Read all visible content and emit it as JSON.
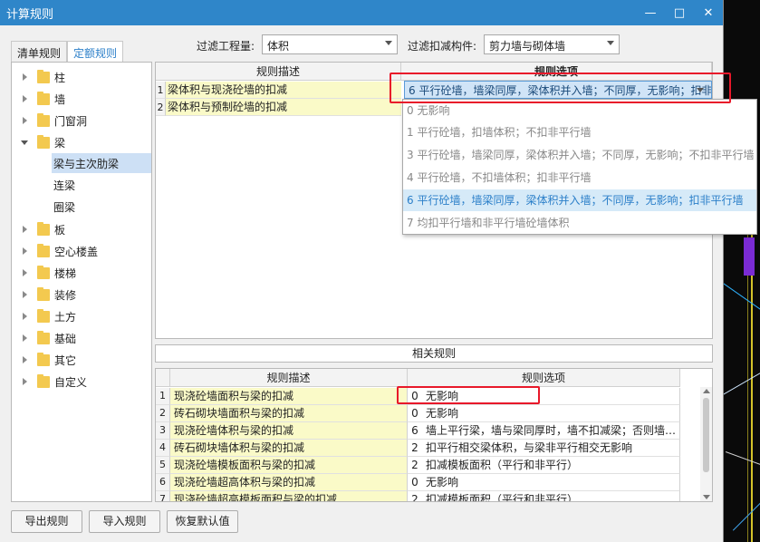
{
  "window": {
    "title": "计算规则",
    "minimize": "—",
    "maximize": "□",
    "close": "✕"
  },
  "filters": {
    "quantity_label": "过滤工程量:",
    "quantity_value": "体积",
    "component_label": "过滤扣减构件:",
    "component_value": "剪力墙与砌体墙"
  },
  "tabs": [
    {
      "label": "清单规则"
    },
    {
      "label": "定额规则"
    }
  ],
  "tree": {
    "items": [
      {
        "label": "柱"
      },
      {
        "label": "墙"
      },
      {
        "label": "门窗洞"
      },
      {
        "label": "梁"
      },
      {
        "label": "板"
      },
      {
        "label": "空心楼盖"
      },
      {
        "label": "楼梯"
      },
      {
        "label": "装修"
      },
      {
        "label": "土方"
      },
      {
        "label": "基础"
      },
      {
        "label": "其它"
      },
      {
        "label": "自定义"
      }
    ],
    "sub_items": [
      {
        "label": "梁与主次肋梁"
      },
      {
        "label": "连梁"
      },
      {
        "label": "圈梁"
      }
    ]
  },
  "rule_grid": {
    "header_desc": "规则描述",
    "header_option": "规则选项",
    "rows": [
      {
        "num": "1",
        "desc": "梁体积与现浇砼墙的扣减"
      },
      {
        "num": "2",
        "desc": "梁体积与预制砼墙的扣减"
      }
    ],
    "selected_option": "6 平行砼墙，墙梁同厚，梁体积并入墙；不同厚，无影响；扣非平行墙"
  },
  "dropdown": {
    "options": [
      {
        "label": "0  无影响"
      },
      {
        "label": "1 平行砼墙，扣墙体积；不扣非平行墙"
      },
      {
        "label": "3 平行砼墙，墙梁同厚，梁体积并入墙；不同厚，无影响；不扣非平行墙"
      },
      {
        "label": "4 平行砼墙，不扣墙体积；扣非平行墙"
      },
      {
        "label": "6 平行砼墙，墙梁同厚，梁体积并入墙；不同厚，无影响；扣非平行墙"
      },
      {
        "label": "7 均扣平行墙和非平行墙砼墙体积"
      }
    ]
  },
  "related": {
    "title": "相关规则",
    "header_desc": "规则描述",
    "header_option": "规则选项",
    "rows": [
      {
        "num": "1",
        "desc": "现浇砼墙面积与梁的扣减",
        "opt_num": "0",
        "opt": "无影响"
      },
      {
        "num": "2",
        "desc": "砖石砌块墙面积与梁的扣减",
        "opt_num": "0",
        "opt": "无影响"
      },
      {
        "num": "3",
        "desc": "现浇砼墙体积与梁的扣减",
        "opt_num": "6",
        "opt": "墙上平行梁，墙与梁同厚时，墙不扣减梁；否则墙…"
      },
      {
        "num": "4",
        "desc": "砖石砌块墙体积与梁的扣减",
        "opt_num": "2",
        "opt": "扣平行相交梁体积，与梁非平行相交无影响"
      },
      {
        "num": "5",
        "desc": "现浇砼墙模板面积与梁的扣减",
        "opt_num": "2",
        "opt": "扣减模板面积（平行和非平行）"
      },
      {
        "num": "6",
        "desc": "现浇砼墙超高体积与梁的扣减",
        "opt_num": "0",
        "opt": "无影响"
      },
      {
        "num": "7",
        "desc": "现浇砼墙超高模板面积与梁的扣减",
        "opt_num": "2",
        "opt": "扣减模板面积（平行和非平行）"
      }
    ]
  },
  "buttons": {
    "export": "导出规则",
    "import": "导入规则",
    "restore": "恢复默认值"
  },
  "colors": {
    "titlebar": "#2f86c9",
    "highlight_box": "#e8182a",
    "desc_cell": "#fafac8"
  }
}
